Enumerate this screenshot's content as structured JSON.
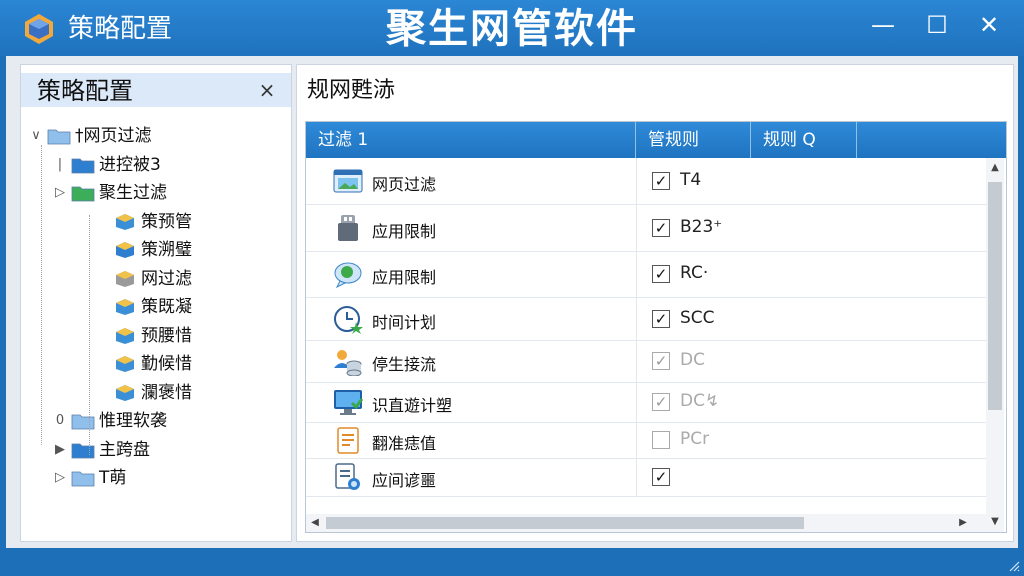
{
  "window": {
    "app_title": "策略配置",
    "main_title": "聚生网管软件",
    "minimize_label": "—",
    "maximize_label": "☐",
    "close_label": "✕"
  },
  "left_panel": {
    "title": "策略配置",
    "close_label": "×",
    "tree": [
      {
        "label": "†网页过滤",
        "twisty": "∨",
        "level": 0
      },
      {
        "label": "进控被3",
        "twisty": "|",
        "level": 1
      },
      {
        "label": "聚生过滤",
        "twisty": "▷",
        "level": 1
      },
      {
        "label": "策预管",
        "twisty": "",
        "level": 2
      },
      {
        "label": "策溯璧",
        "twisty": "",
        "level": 2
      },
      {
        "label": "网过滤",
        "twisty": "",
        "level": 2
      },
      {
        "label": "策既凝",
        "twisty": "",
        "level": 2
      },
      {
        "label": "预腰惜",
        "twisty": "",
        "level": 2
      },
      {
        "label": "勤候惜",
        "twisty": "",
        "level": 2
      },
      {
        "label": "瀾褒惜",
        "twisty": "",
        "level": 2
      },
      {
        "label": "惟理软袭",
        "twisty": "0",
        "level": 1
      },
      {
        "label": "主跨盘",
        "twisty": "▶",
        "level": 1
      },
      {
        "label": "T萌",
        "twisty": "▷",
        "level": 1
      }
    ]
  },
  "right_panel": {
    "title": "规网甦浾",
    "columns": [
      "过滤 1",
      "管规则",
      "规则 Q"
    ],
    "rows": [
      {
        "name": "网页过滤",
        "checked": true,
        "check_mark": "✓",
        "value": "T4",
        "faded": false,
        "icon": "browser-window-icon"
      },
      {
        "name": "应用限制",
        "checked": true,
        "check_mark": "✓",
        "value": "B23⁺",
        "faded": false,
        "icon": "usb-drive-icon"
      },
      {
        "name": "应用限制",
        "checked": true,
        "check_mark": "✓",
        "value": "RC·",
        "faded": false,
        "icon": "chat-bubble-icon"
      },
      {
        "name": "时间计划",
        "checked": true,
        "check_mark": "✓",
        "value": "SCC",
        "faded": false,
        "icon": "clock-icon"
      },
      {
        "name": "停生接流",
        "checked": true,
        "check_mark": "✓",
        "value": "DC",
        "faded": true,
        "icon": "user-database-icon"
      },
      {
        "name": "识直遊计塑",
        "checked": true,
        "check_mark": "✓",
        "value": "DC↯",
        "faded": true,
        "icon": "monitor-icon"
      },
      {
        "name": "翻准痣值",
        "checked": false,
        "check_mark": "",
        "value": "PCr",
        "faded": true,
        "icon": "document-list-icon"
      },
      {
        "name": "应间谚噩",
        "checked": true,
        "check_mark": "✓",
        "value": "",
        "faded": false,
        "icon": "document-search-icon"
      }
    ],
    "scroll_up": "▲",
    "scroll_down": "▼",
    "scroll_left": "◀",
    "scroll_right": "▶"
  },
  "colors": {
    "title_bar": "#2b86d4",
    "header_blue": "#1f74c0",
    "panel_header": "#dbe9f8"
  }
}
